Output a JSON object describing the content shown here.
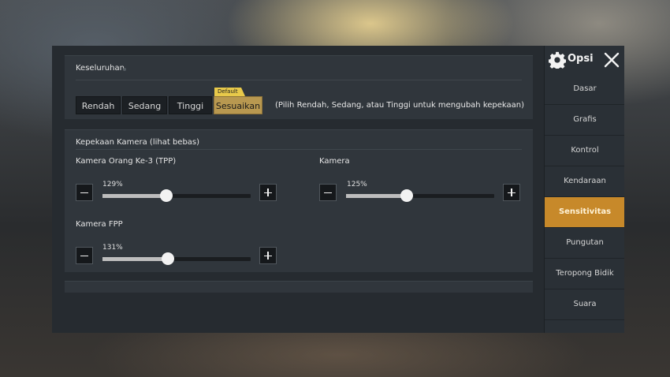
{
  "overall": {
    "title": "Keseluruhan",
    "buttons": [
      "Rendah",
      "Sedang",
      "Tinggi",
      "Sesuaikan"
    ],
    "selected": "Sesuaikan",
    "default_tag": "Default",
    "hint": "(Pilih Rendah, Sedang, atau Tinggi untuk mengubah kepekaan)"
  },
  "camera": {
    "title": "Kepekaan Kamera (lihat bebas)",
    "tpp": {
      "label": "Kamera Orang Ke-3 (TPP)",
      "value_text": "129%",
      "level": 0.43
    },
    "camera": {
      "label": "Kamera",
      "value_text": "125%",
      "level": 0.41
    },
    "fpp": {
      "label": "Kamera FPP",
      "value_text": "131%",
      "level": 0.44
    }
  },
  "sidebar": {
    "title": "Opsi",
    "items": [
      {
        "label": "Dasar"
      },
      {
        "label": "Grafis"
      },
      {
        "label": "Kontrol"
      },
      {
        "label": "Kendaraan"
      },
      {
        "label": "Sensitivitas"
      },
      {
        "label": "Pungutan"
      },
      {
        "label": "Teropong Bidik"
      },
      {
        "label": "Suara"
      }
    ],
    "active_index": 4
  },
  "colors": {
    "accent": "#c7892a",
    "selected_button": "#b89850",
    "default_tag": "#e8c94a"
  },
  "icons": [
    "gear-icon",
    "close-icon",
    "minus-icon",
    "plus-icon"
  ]
}
